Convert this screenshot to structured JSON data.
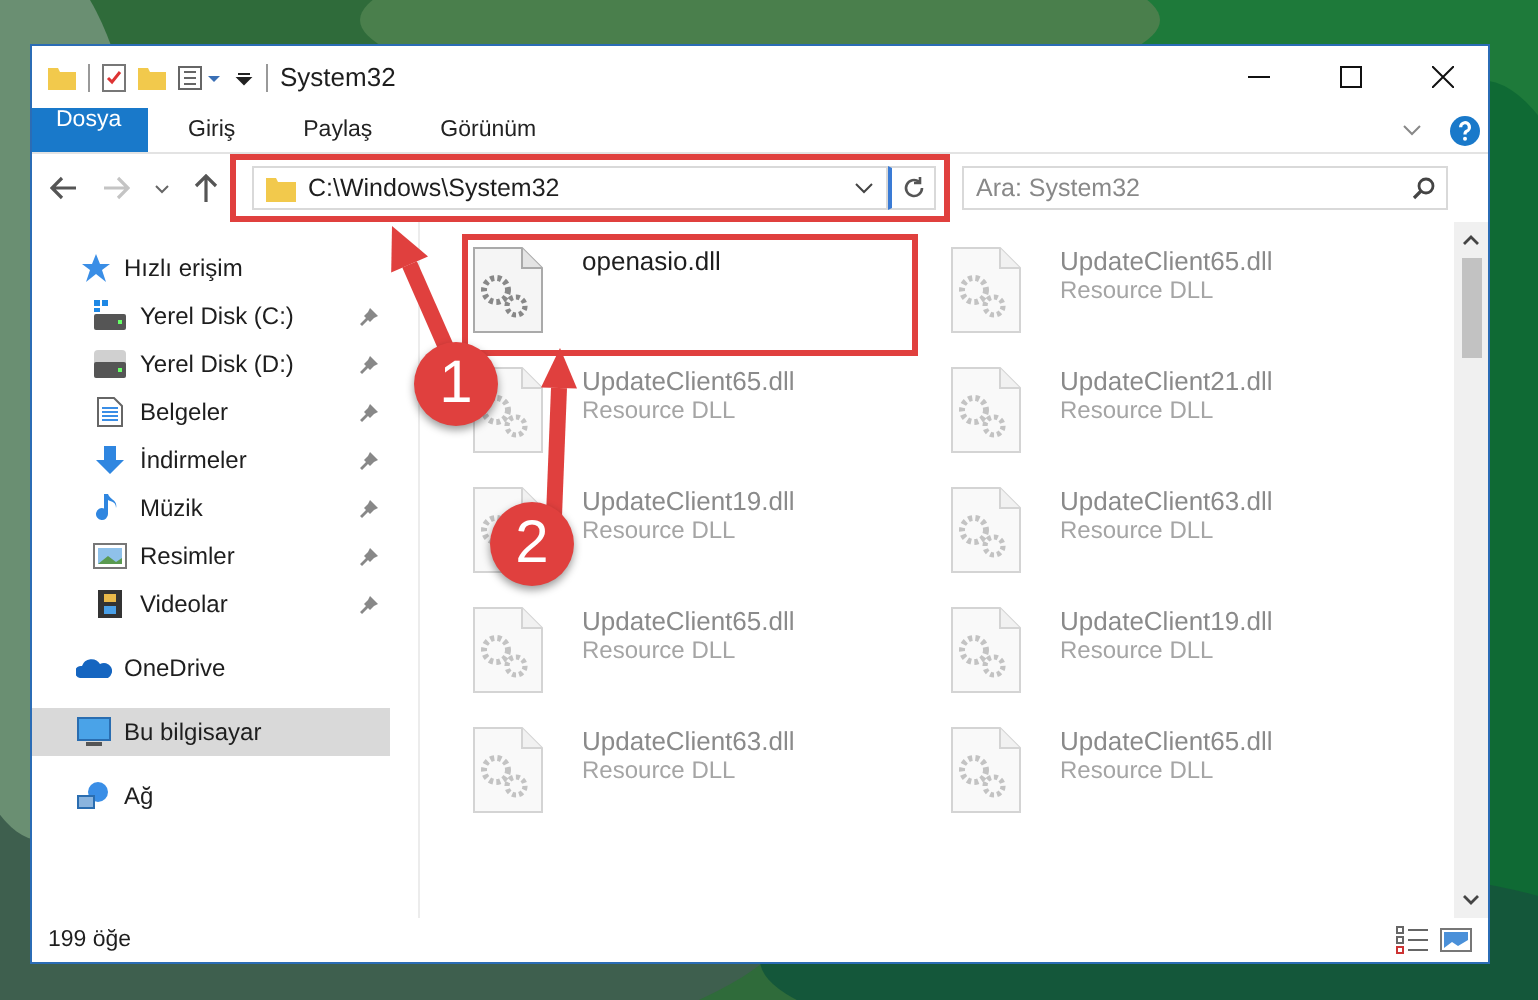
{
  "window": {
    "title": "System32"
  },
  "ribbon": {
    "tabs": [
      {
        "label": "Dosya",
        "kind": "file",
        "selected": false
      },
      {
        "label": "Giriş",
        "kind": "tab",
        "selected": false
      },
      {
        "label": "Paylaş",
        "kind": "tab",
        "selected": false
      },
      {
        "label": "Görünüm",
        "kind": "tab",
        "selected": false
      }
    ]
  },
  "navigation": {
    "back_disabled": false,
    "forward_disabled": true
  },
  "address_bar": {
    "value": "C:\\Windows\\System32"
  },
  "search": {
    "placeholder": "Ara: System32"
  },
  "sidebar": {
    "items": [
      {
        "label": "Hızlı erişim",
        "kind": "star",
        "selected": false,
        "children": [
          {
            "label": "Yerel Disk (C:)",
            "kind": "drive-win",
            "pinned": true,
            "selected": false
          },
          {
            "label": "Yerel Disk (D:)",
            "kind": "drive",
            "pinned": true,
            "selected": false
          },
          {
            "label": "Belgeler",
            "kind": "docs",
            "pinned": true,
            "selected": false
          },
          {
            "label": "İndirmeler",
            "kind": "download",
            "pinned": true,
            "selected": false
          },
          {
            "label": "Müzik",
            "kind": "music",
            "pinned": true,
            "selected": false
          },
          {
            "label": "Resimler",
            "kind": "pictures",
            "pinned": true,
            "selected": false
          },
          {
            "label": "Videolar",
            "kind": "videos",
            "pinned": true,
            "selected": false
          }
        ]
      },
      {
        "label": "OneDrive",
        "kind": "cloud",
        "selected": false
      },
      {
        "label": "Bu bilgisayar",
        "kind": "pc",
        "selected": true
      },
      {
        "label": "Ağ",
        "kind": "network",
        "selected": false
      }
    ]
  },
  "files": [
    {
      "name": "openasio.dll",
      "blurred": false
    },
    {
      "name": "UpdateClient65.dll",
      "type": "Resource DLL",
      "blurred": true
    },
    {
      "name": "UpdateClient65.dll",
      "type": "Resource DLL",
      "blurred": true
    },
    {
      "name": "UpdateClient21.dll",
      "type": "Resource DLL",
      "blurred": true
    },
    {
      "name": "UpdateClient19.dll",
      "type": "Resource DLL",
      "blurred": true
    },
    {
      "name": "UpdateClient63.dll",
      "type": "Resource DLL",
      "blurred": true
    },
    {
      "name": "UpdateClient65.dll",
      "type": "Resource DLL",
      "blurred": true
    },
    {
      "name": "UpdateClient19.dll",
      "type": "Resource DLL",
      "blurred": true
    },
    {
      "name": "UpdateClient63.dll",
      "type": "Resource DLL",
      "blurred": true
    },
    {
      "name": "UpdateClient65.dll",
      "type": "Resource DLL",
      "blurred": true
    }
  ],
  "status_bar": {
    "count": "199 öğe"
  },
  "annotations": [
    {
      "label": "1"
    },
    {
      "label": "2"
    }
  ]
}
